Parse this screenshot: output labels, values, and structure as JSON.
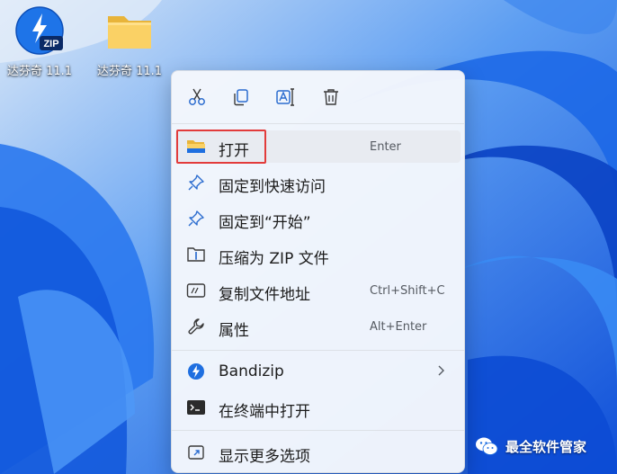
{
  "desktop": {
    "icons": [
      {
        "label": "达芬奇 11.1",
        "icon": "bandizip-zip-icon",
        "badge": "ZIP"
      },
      {
        "label": "达芬奇 11.1",
        "icon": "folder-icon"
      }
    ]
  },
  "context_menu": {
    "toolbar": [
      {
        "icon": "cut-icon"
      },
      {
        "icon": "copy-icon"
      },
      {
        "icon": "rename-icon"
      },
      {
        "icon": "delete-icon"
      }
    ],
    "items": [
      {
        "label": "打开",
        "shortcut": "Enter",
        "icon": "folder-open-icon"
      },
      {
        "label": "固定到快速访问",
        "shortcut": "",
        "icon": "pin-icon"
      },
      {
        "label": "固定到“开始”",
        "shortcut": "",
        "icon": "pin-icon"
      },
      {
        "label": "压缩为 ZIP 文件",
        "shortcut": "",
        "icon": "zip-compress-icon"
      },
      {
        "label": "复制文件地址",
        "shortcut": "Ctrl+Shift+C",
        "icon": "copy-path-icon"
      },
      {
        "label": "属性",
        "shortcut": "Alt+Enter",
        "icon": "wrench-icon"
      },
      {
        "label": "Bandizip",
        "shortcut": "",
        "icon": "bandizip-icon",
        "submenu": true
      },
      {
        "label": "在终端中打开",
        "shortcut": "",
        "icon": "terminal-icon"
      },
      {
        "label": "显示更多选项",
        "shortcut": "",
        "icon": "more-options-icon"
      }
    ]
  },
  "watermark": {
    "text": "最全软件管家",
    "icon": "wechat-icon"
  },
  "colors": {
    "highlight_box": "#e23b3b",
    "menu_bg": "#f4f7fc",
    "accent_blue": "#1f6fe0"
  }
}
